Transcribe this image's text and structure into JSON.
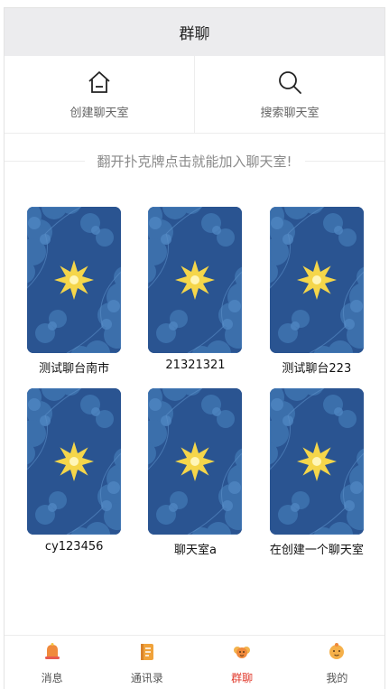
{
  "header": {
    "title": "群聊"
  },
  "actions": [
    {
      "label": "创建聊天室",
      "icon": "home-icon"
    },
    {
      "label": "搜索聊天室",
      "icon": "search-icon"
    }
  ],
  "hint": "翻开扑克牌点击就能加入聊天室!",
  "rooms": [
    {
      "name": "测试聊台南市"
    },
    {
      "name": "21321321"
    },
    {
      "name": "测试聊台223"
    },
    {
      "name": "cy123456"
    },
    {
      "name": "聊天室a"
    },
    {
      "name": "在创建一个聊天室"
    }
  ],
  "tabs": [
    {
      "label": "消息",
      "icon": "message-icon",
      "active": false
    },
    {
      "label": "通讯录",
      "icon": "contacts-icon",
      "active": false
    },
    {
      "label": "群聊",
      "icon": "group-chat-icon",
      "active": true
    },
    {
      "label": "我的",
      "icon": "profile-icon",
      "active": false
    }
  ],
  "colors": {
    "active_tab": "#e0392b",
    "card_bg": "#2a5491",
    "star": "#f5d64a"
  }
}
